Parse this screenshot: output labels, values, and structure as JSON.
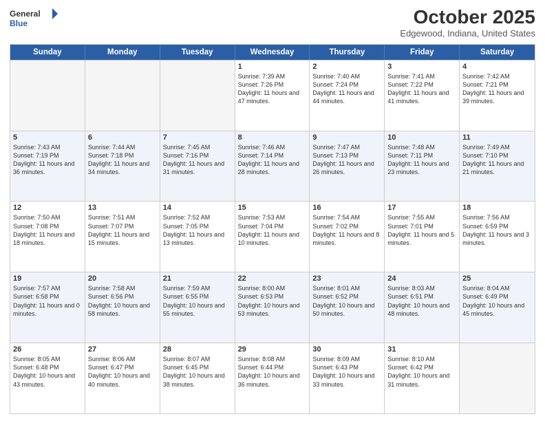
{
  "header": {
    "logo_line1": "General",
    "logo_line2": "Blue",
    "title": "October 2025",
    "subtitle": "Edgewood, Indiana, United States"
  },
  "days_of_week": [
    "Sunday",
    "Monday",
    "Tuesday",
    "Wednesday",
    "Thursday",
    "Friday",
    "Saturday"
  ],
  "rows": [
    [
      {
        "num": "",
        "text": "",
        "empty": true
      },
      {
        "num": "",
        "text": "",
        "empty": true
      },
      {
        "num": "",
        "text": "",
        "empty": true
      },
      {
        "num": "1",
        "text": "Sunrise: 7:39 AM\nSunset: 7:26 PM\nDaylight: 11 hours and 47 minutes."
      },
      {
        "num": "2",
        "text": "Sunrise: 7:40 AM\nSunset: 7:24 PM\nDaylight: 11 hours and 44 minutes."
      },
      {
        "num": "3",
        "text": "Sunrise: 7:41 AM\nSunset: 7:22 PM\nDaylight: 11 hours and 41 minutes."
      },
      {
        "num": "4",
        "text": "Sunrise: 7:42 AM\nSunset: 7:21 PM\nDaylight: 11 hours and 39 minutes."
      }
    ],
    [
      {
        "num": "5",
        "text": "Sunrise: 7:43 AM\nSunset: 7:19 PM\nDaylight: 11 hours and 36 minutes."
      },
      {
        "num": "6",
        "text": "Sunrise: 7:44 AM\nSunset: 7:18 PM\nDaylight: 11 hours and 34 minutes."
      },
      {
        "num": "7",
        "text": "Sunrise: 7:45 AM\nSunset: 7:16 PM\nDaylight: 11 hours and 31 minutes."
      },
      {
        "num": "8",
        "text": "Sunrise: 7:46 AM\nSunset: 7:14 PM\nDaylight: 11 hours and 28 minutes."
      },
      {
        "num": "9",
        "text": "Sunrise: 7:47 AM\nSunset: 7:13 PM\nDaylight: 11 hours and 26 minutes."
      },
      {
        "num": "10",
        "text": "Sunrise: 7:48 AM\nSunset: 7:11 PM\nDaylight: 11 hours and 23 minutes."
      },
      {
        "num": "11",
        "text": "Sunrise: 7:49 AM\nSunset: 7:10 PM\nDaylight: 11 hours and 21 minutes."
      }
    ],
    [
      {
        "num": "12",
        "text": "Sunrise: 7:50 AM\nSunset: 7:08 PM\nDaylight: 11 hours and 18 minutes."
      },
      {
        "num": "13",
        "text": "Sunrise: 7:51 AM\nSunset: 7:07 PM\nDaylight: 11 hours and 15 minutes."
      },
      {
        "num": "14",
        "text": "Sunrise: 7:52 AM\nSunset: 7:05 PM\nDaylight: 11 hours and 13 minutes."
      },
      {
        "num": "15",
        "text": "Sunrise: 7:53 AM\nSunset: 7:04 PM\nDaylight: 11 hours and 10 minutes."
      },
      {
        "num": "16",
        "text": "Sunrise: 7:54 AM\nSunset: 7:02 PM\nDaylight: 11 hours and 8 minutes."
      },
      {
        "num": "17",
        "text": "Sunrise: 7:55 AM\nSunset: 7:01 PM\nDaylight: 11 hours and 5 minutes."
      },
      {
        "num": "18",
        "text": "Sunrise: 7:56 AM\nSunset: 6:59 PM\nDaylight: 11 hours and 3 minutes."
      }
    ],
    [
      {
        "num": "19",
        "text": "Sunrise: 7:57 AM\nSunset: 6:58 PM\nDaylight: 11 hours and 0 minutes."
      },
      {
        "num": "20",
        "text": "Sunrise: 7:58 AM\nSunset: 6:56 PM\nDaylight: 10 hours and 58 minutes."
      },
      {
        "num": "21",
        "text": "Sunrise: 7:59 AM\nSunset: 6:55 PM\nDaylight: 10 hours and 55 minutes."
      },
      {
        "num": "22",
        "text": "Sunrise: 8:00 AM\nSunset: 6:53 PM\nDaylight: 10 hours and 53 minutes."
      },
      {
        "num": "23",
        "text": "Sunrise: 8:01 AM\nSunset: 6:52 PM\nDaylight: 10 hours and 50 minutes."
      },
      {
        "num": "24",
        "text": "Sunrise: 8:03 AM\nSunset: 6:51 PM\nDaylight: 10 hours and 48 minutes."
      },
      {
        "num": "25",
        "text": "Sunrise: 8:04 AM\nSunset: 6:49 PM\nDaylight: 10 hours and 45 minutes."
      }
    ],
    [
      {
        "num": "26",
        "text": "Sunrise: 8:05 AM\nSunset: 6:48 PM\nDaylight: 10 hours and 43 minutes."
      },
      {
        "num": "27",
        "text": "Sunrise: 8:06 AM\nSunset: 6:47 PM\nDaylight: 10 hours and 40 minutes."
      },
      {
        "num": "28",
        "text": "Sunrise: 8:07 AM\nSunset: 6:45 PM\nDaylight: 10 hours and 38 minutes."
      },
      {
        "num": "29",
        "text": "Sunrise: 8:08 AM\nSunset: 6:44 PM\nDaylight: 10 hours and 36 minutes."
      },
      {
        "num": "30",
        "text": "Sunrise: 8:09 AM\nSunset: 6:43 PM\nDaylight: 10 hours and 33 minutes."
      },
      {
        "num": "31",
        "text": "Sunrise: 8:10 AM\nSunset: 6:42 PM\nDaylight: 10 hours and 31 minutes."
      },
      {
        "num": "",
        "text": "",
        "empty": true
      }
    ]
  ]
}
